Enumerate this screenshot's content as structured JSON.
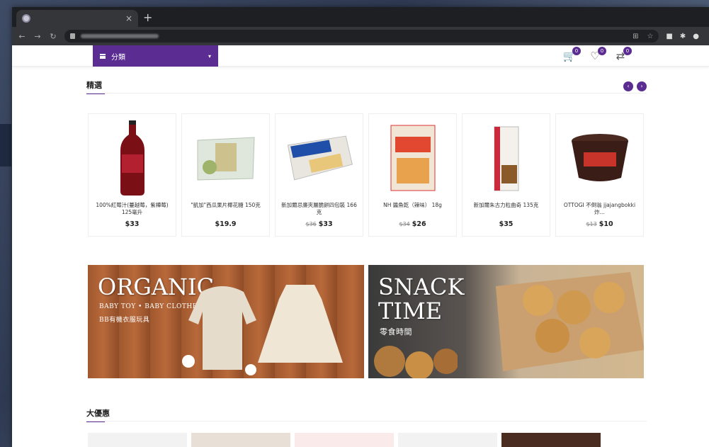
{
  "browser": {
    "tab_close": "×",
    "new_tab": "+",
    "nav": {
      "back": "←",
      "forward": "→",
      "reload": "↻"
    }
  },
  "header": {
    "category_label": "分類",
    "cart_count": "0",
    "wishlist_count": "0",
    "compare_count": "0"
  },
  "featured": {
    "title": "精選",
    "products": [
      {
        "name": "100%紅莓汁(蔓越莓，紫樺莓) 125毫升",
        "old_price": "",
        "price": "$33"
      },
      {
        "name": "\"凱加\"西瓜果片椰花糖 150克",
        "old_price": "",
        "price": "$19.9"
      },
      {
        "name": "新加爾忌廉夾層脆餅四包裝 166克",
        "old_price": "$36",
        "price": "$33"
      },
      {
        "name": "NH 醬魚乾（辣味） 18g",
        "old_price": "$34",
        "price": "$26"
      },
      {
        "name": "新加爾朱古力粒曲奇 135克",
        "old_price": "",
        "price": "$35"
      },
      {
        "name": "OTTOGI 不倒翁 jjajangbokki 炸...",
        "old_price": "$13",
        "price": "$10"
      }
    ]
  },
  "banners": {
    "organic": {
      "title": "ORGANIC",
      "sub1": "BABY TOY • BABY CLOTHES",
      "sub2": "BB有機衣服玩具"
    },
    "snack": {
      "title_line1": "SNACK",
      "title_line2": "TIME",
      "sub": "零食時間"
    }
  },
  "deals": {
    "title": "大優惠"
  }
}
